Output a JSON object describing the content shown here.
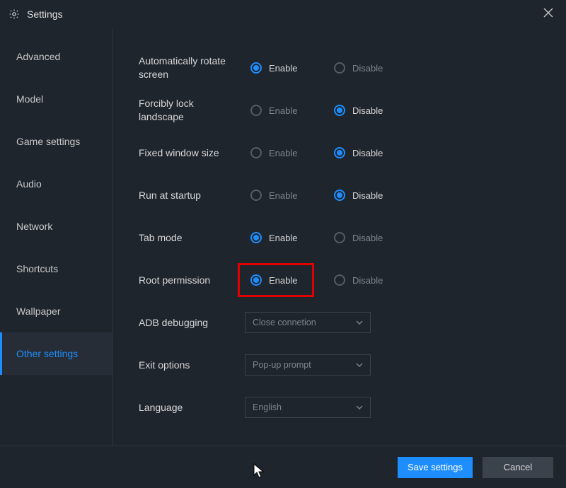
{
  "window": {
    "title": "Settings"
  },
  "sidebar": {
    "items": [
      {
        "label": "Advanced",
        "active": false
      },
      {
        "label": "Model",
        "active": false
      },
      {
        "label": "Game settings",
        "active": false
      },
      {
        "label": "Audio",
        "active": false
      },
      {
        "label": "Network",
        "active": false
      },
      {
        "label": "Shortcuts",
        "active": false
      },
      {
        "label": "Wallpaper",
        "active": false
      },
      {
        "label": "Other settings",
        "active": true
      }
    ]
  },
  "options": {
    "enable_label": "Enable",
    "disable_label": "Disable",
    "rows": [
      {
        "key": "auto_rotate",
        "label": "Automatically rotate screen",
        "value": "enable",
        "highlight": false
      },
      {
        "key": "forcibly_lock",
        "label": "Forcibly lock landscape",
        "value": "disable",
        "highlight": false
      },
      {
        "key": "fixed_window",
        "label": "Fixed window size",
        "value": "disable",
        "highlight": false
      },
      {
        "key": "run_startup",
        "label": "Run at startup",
        "value": "disable",
        "highlight": false
      },
      {
        "key": "tab_mode",
        "label": "Tab mode",
        "value": "enable",
        "highlight": false
      },
      {
        "key": "root_permission",
        "label": "Root permission",
        "value": "enable",
        "highlight": true
      }
    ],
    "selects": [
      {
        "key": "adb_debugging",
        "label": "ADB debugging",
        "value": "Close connetion"
      },
      {
        "key": "exit_options",
        "label": "Exit options",
        "value": "Pop-up prompt"
      },
      {
        "key": "language",
        "label": "Language",
        "value": "English"
      }
    ]
  },
  "footer": {
    "save_label": "Save settings",
    "cancel_label": "Cancel"
  }
}
